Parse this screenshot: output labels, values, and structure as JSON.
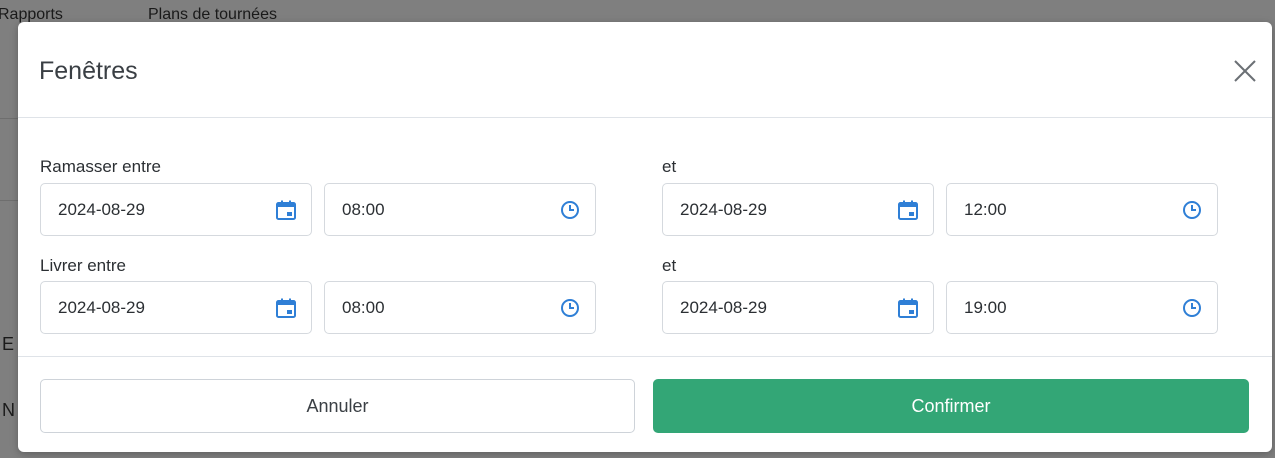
{
  "background": {
    "nav_items": [
      "Rapports",
      "Plans de tournées"
    ],
    "fragments": [
      "E",
      "N"
    ]
  },
  "modal": {
    "title": "Fenêtres",
    "close_icon": "close-icon",
    "pickup": {
      "label_from": "Ramasser entre",
      "label_to": "et",
      "from_date": "2024-08-29",
      "from_time": "08:00",
      "to_date": "2024-08-29",
      "to_time": "12:00"
    },
    "delivery": {
      "label_from": "Livrer entre",
      "label_to": "et",
      "from_date": "2024-08-29",
      "from_time": "08:00",
      "to_date": "2024-08-29",
      "to_time": "19:00"
    },
    "footer": {
      "cancel_label": "Annuler",
      "confirm_label": "Confirmer"
    }
  },
  "colors": {
    "accent_blue": "#2f7fd6",
    "confirm_green": "#33a676",
    "overlay": "#7f7f7f"
  }
}
